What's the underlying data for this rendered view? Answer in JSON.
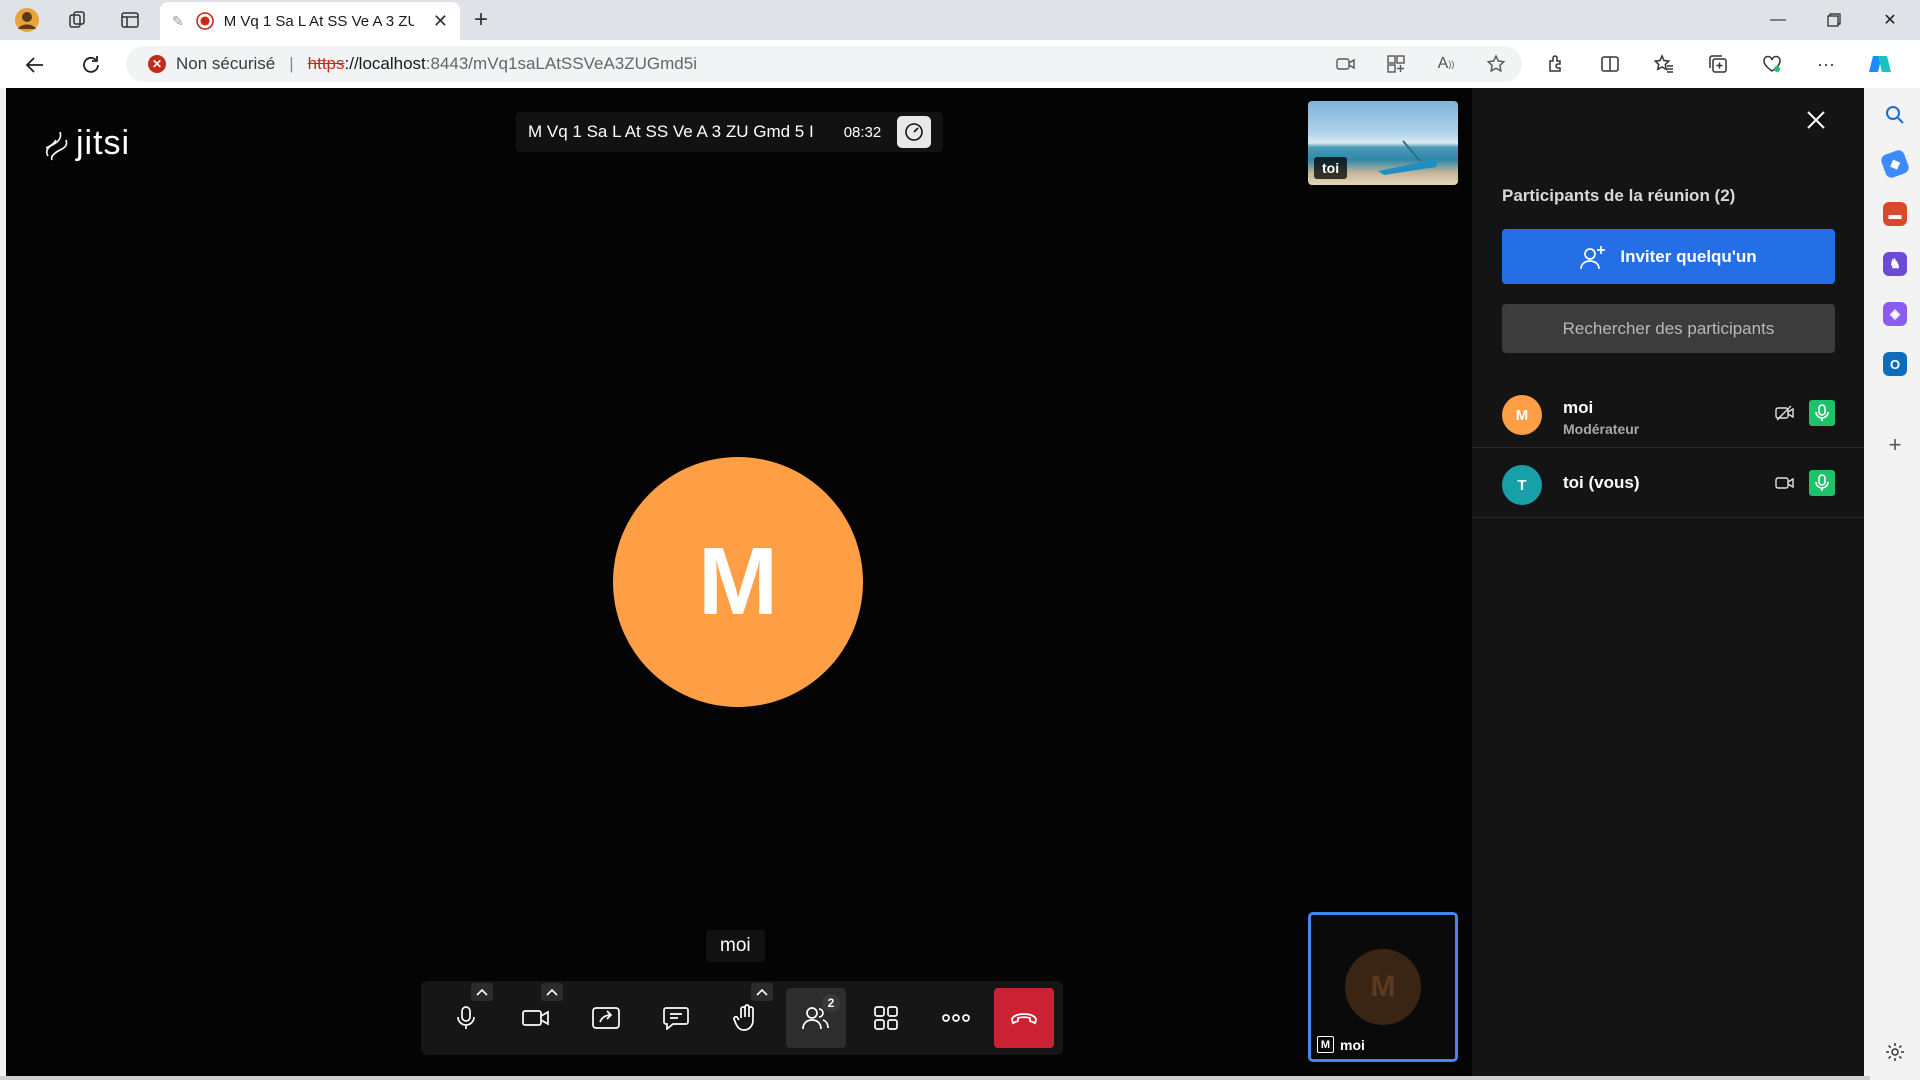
{
  "browser": {
    "tab_title": "M Vq 1 Sa L At SS Ve A 3 ZU Gmd 5 I",
    "security_label": "Non sécurisé",
    "url_scheme": "https",
    "url_host": "://localhost",
    "url_path": ":8443/mVq1saLAtSSVeA3ZUGmd5i"
  },
  "meeting": {
    "logo_text": "jitsi",
    "subject": "M Vq 1 Sa L At SS Ve A 3 ZU Gmd 5 I",
    "timer": "08:32",
    "dominant_speaker_initial": "M",
    "dominant_speaker_name": "moi",
    "dominant_speaker_color": "#ff9f45"
  },
  "toolbar": {
    "participants_count": "2",
    "buttons": [
      "microphone-icon",
      "camera-icon",
      "screenshare-icon",
      "chat-icon",
      "raise-hand-icon",
      "participants-icon",
      "tile-view-icon",
      "more-icon",
      "hangup-icon"
    ],
    "hangup_color": "#cb2233"
  },
  "filmstrip": {
    "remote_label": "toi",
    "local_initial": "M",
    "local_label": "moi"
  },
  "panel": {
    "title": "Participants de la réunion (2)",
    "invite_label": "Inviter quelqu'un",
    "search_placeholder": "Rechercher des participants",
    "participants": [
      {
        "initial": "M",
        "name": "moi",
        "role": "Modérateur",
        "color": "#ff9f45",
        "camera": "off",
        "mic": "on"
      },
      {
        "initial": "T",
        "name": "toi (vous)",
        "role": "",
        "color": "#17a0a8",
        "camera": "on",
        "mic": "on"
      }
    ],
    "accent_color": "#246fe5",
    "mic_on_color": "#1ec26a"
  }
}
